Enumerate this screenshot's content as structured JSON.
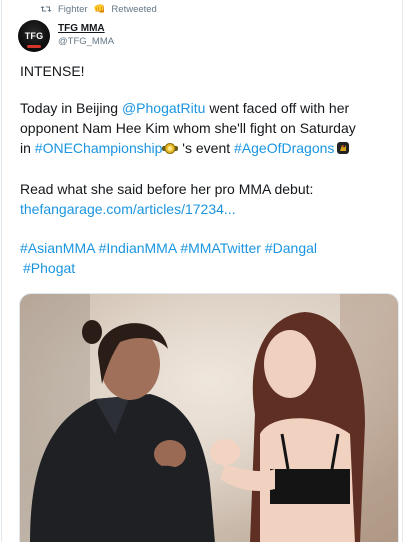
{
  "retweet": {
    "icon": "retweet-icon",
    "user": "Fighter",
    "emoji": "👊",
    "label": "Retweeted"
  },
  "author": {
    "avatar_text": "TFG",
    "name": "TFG MMA",
    "handle": "@TFG_MMA"
  },
  "tweet": {
    "line1": "INTENSE!",
    "p2_l1_a": "Today in Beijing ",
    "p2_l1_mention": "@PhogatRitu",
    "p2_l1_b": " went faced off with her",
    "p2_l2": "opponent Nam Hee Kim whom she'll fight on Saturday",
    "p2_l3_a": "in ",
    "p2_l3_hashtag1": "#ONEChampionship",
    "p2_l3_b": " 's event ",
    "p2_l3_hashtag2": "#AgeOfDragons",
    "p3_l1": "Read what she said before her pro MMA debut:",
    "p3_link": "thefangarage.com/articles/17234...",
    "hashtags_row1": [
      "#AsianMMA",
      "#IndianMMA",
      "#MMATwitter",
      "#Dangal"
    ],
    "hashtags_row2": [
      "#Phogat"
    ]
  },
  "colors": {
    "link": "#1b95e0",
    "text": "#14171a",
    "muted": "#657786"
  }
}
